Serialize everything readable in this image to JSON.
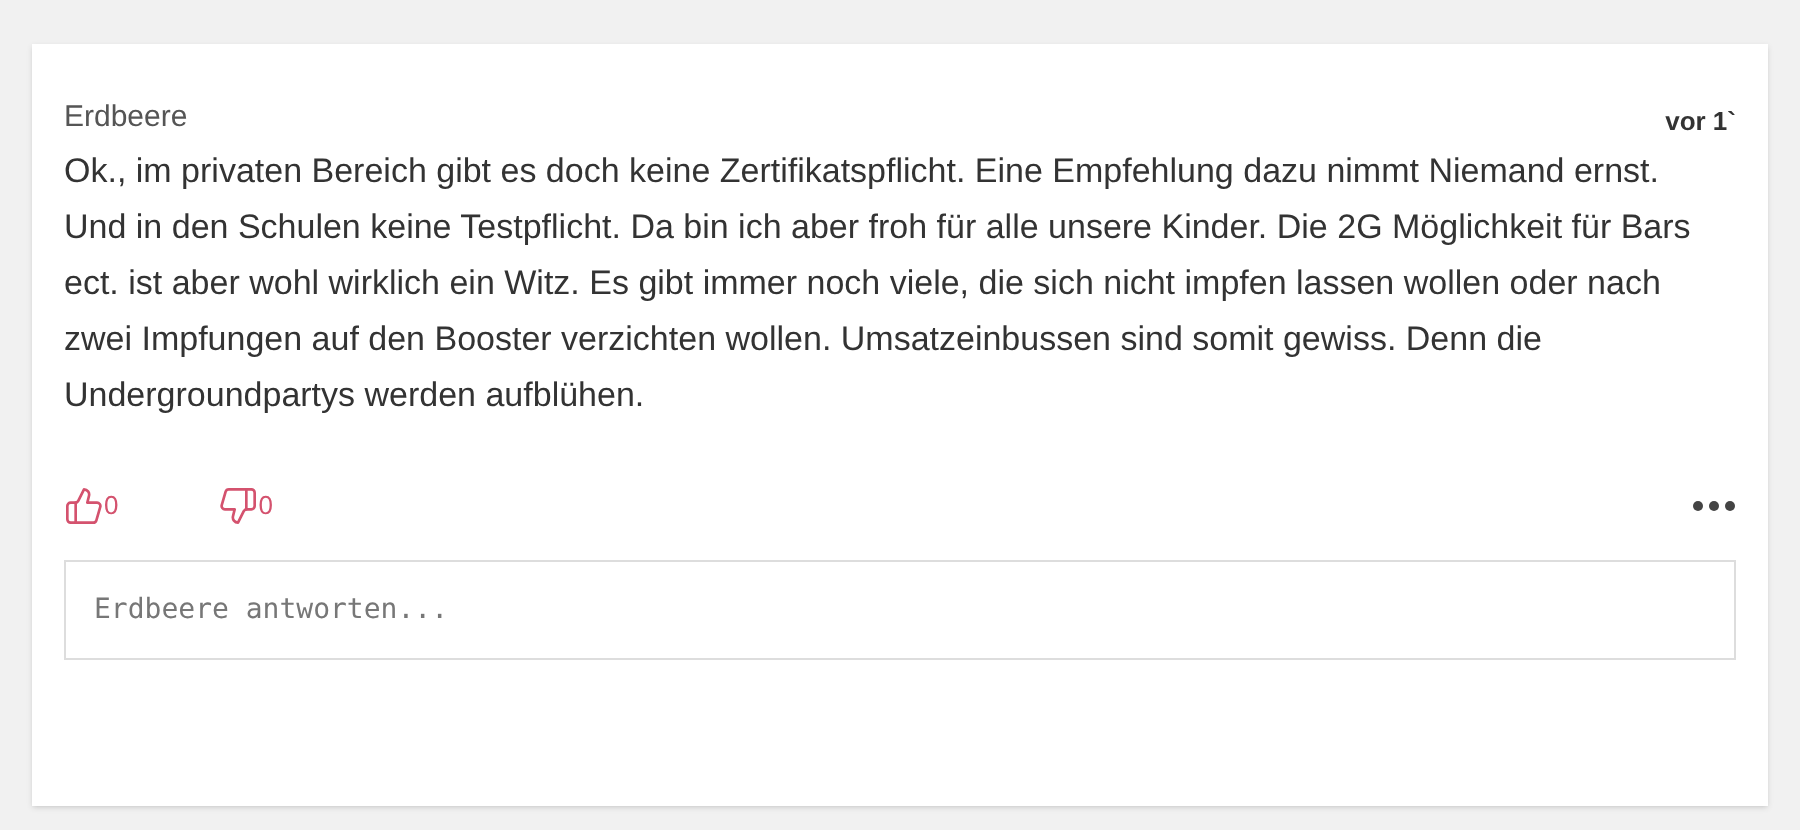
{
  "comment": {
    "author": "Erdbeere",
    "time": "vor 1`",
    "text": "Ok., im privaten Bereich gibt es doch keine Zertifikatspflicht. Eine Empfehlung dazu nimmt Niemand ernst. Und in den Schulen keine Testpflicht. Da bin ich aber froh für alle unsere Kinder. Die 2G Möglichkeit für Bars ect. ist aber wohl wirklich ein Witz. Es gibt immer noch viele, die sich nicht impfen lassen wollen oder nach zwei Impfungen auf den Booster verzichten wollen. Umsatzeinbussen sind somit gewiss. Denn die Undergroundpartys werden aufblühen.",
    "likes": "0",
    "dislikes": "0"
  },
  "reply": {
    "placeholder": "Erdbeere antworten..."
  }
}
